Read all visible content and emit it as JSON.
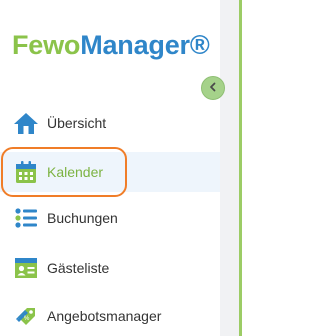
{
  "logo": {
    "part1": "Fewo",
    "part2": "Manager®"
  },
  "colors": {
    "brand_green": "#8bc34a",
    "brand_blue": "#2f86c9",
    "highlight": "#f07d28"
  },
  "sidebar": {
    "items": [
      {
        "label": "Übersicht",
        "icon": "home-icon"
      },
      {
        "label": "Kalender",
        "icon": "calendar-icon",
        "active": true
      },
      {
        "label": "Buchungen",
        "icon": "list-icon"
      },
      {
        "label": "Gästeliste",
        "icon": "guest-card-icon"
      },
      {
        "label": "Angebotsmanager",
        "icon": "tag-icon"
      }
    ]
  }
}
